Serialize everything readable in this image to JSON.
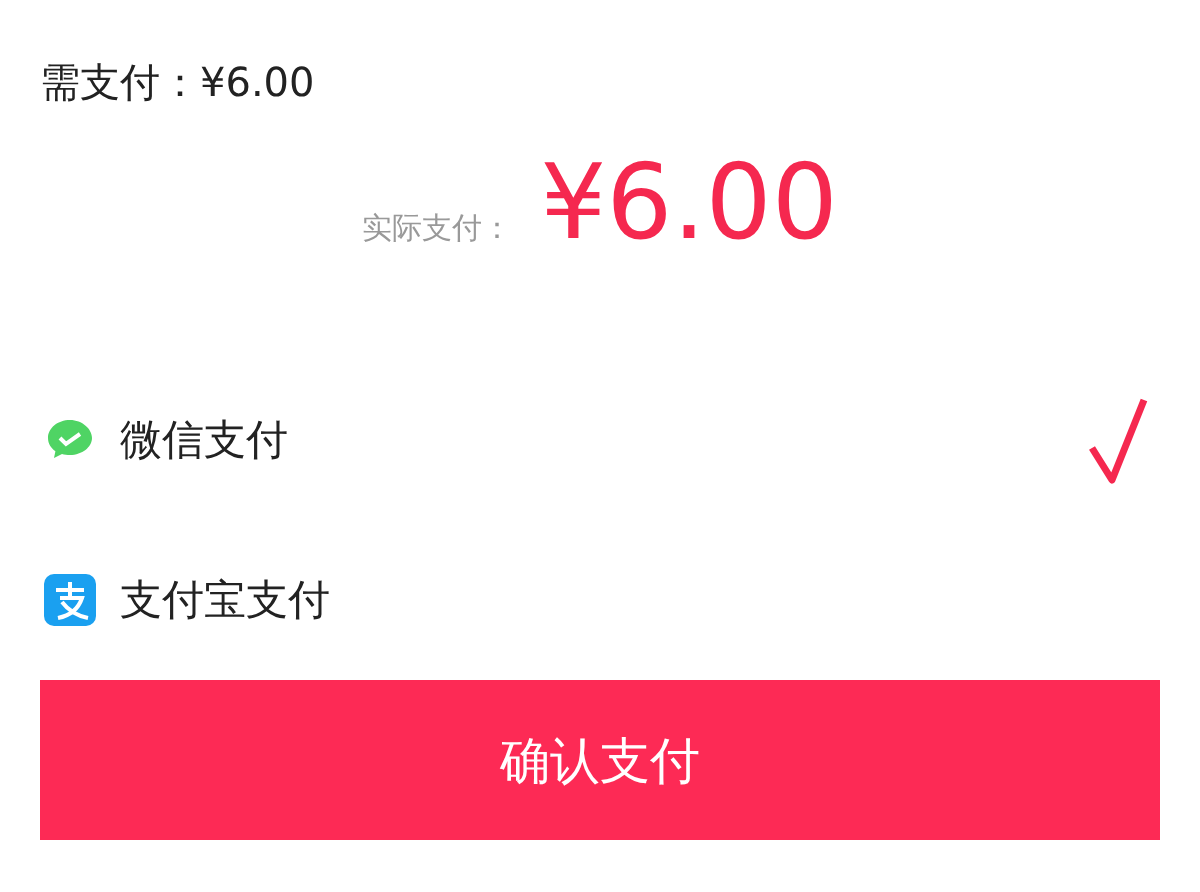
{
  "due": {
    "label": "需支付：¥6.00"
  },
  "actual": {
    "label": "实际支付：",
    "amount": "¥6.00"
  },
  "methods": [
    {
      "kind": "wechat",
      "label": "微信支付",
      "selected": true
    },
    {
      "kind": "alipay",
      "label": "支付宝支付",
      "selected": false
    }
  ],
  "confirm_button": {
    "label": "确认支付"
  }
}
